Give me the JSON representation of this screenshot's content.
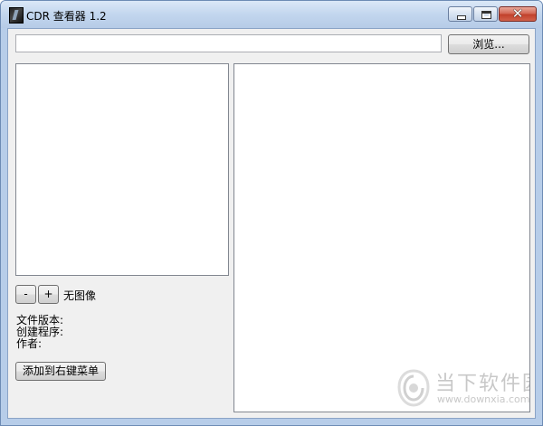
{
  "window": {
    "title": "CDR 查看器 1.2",
    "close_glyph": "✕"
  },
  "path_field": {
    "value": "",
    "placeholder": ""
  },
  "buttons": {
    "browse": "浏览...",
    "zoom_out": "-",
    "zoom_in": "+",
    "add_context_menu": "添加到右键菜单"
  },
  "image_status": "无图像",
  "file_info": {
    "version_label": "文件版本:",
    "creator_label": "创建程序:",
    "author_label": "作者:"
  },
  "watermark": {
    "title": "当下软件园",
    "url": "www.downxia.com"
  },
  "icons": {
    "app": "cdr-app-icon",
    "minimize": "minimize-icon",
    "maximize": "maximize-icon",
    "close": "close-icon",
    "watermark_logo": "downxia-logo-icon"
  }
}
